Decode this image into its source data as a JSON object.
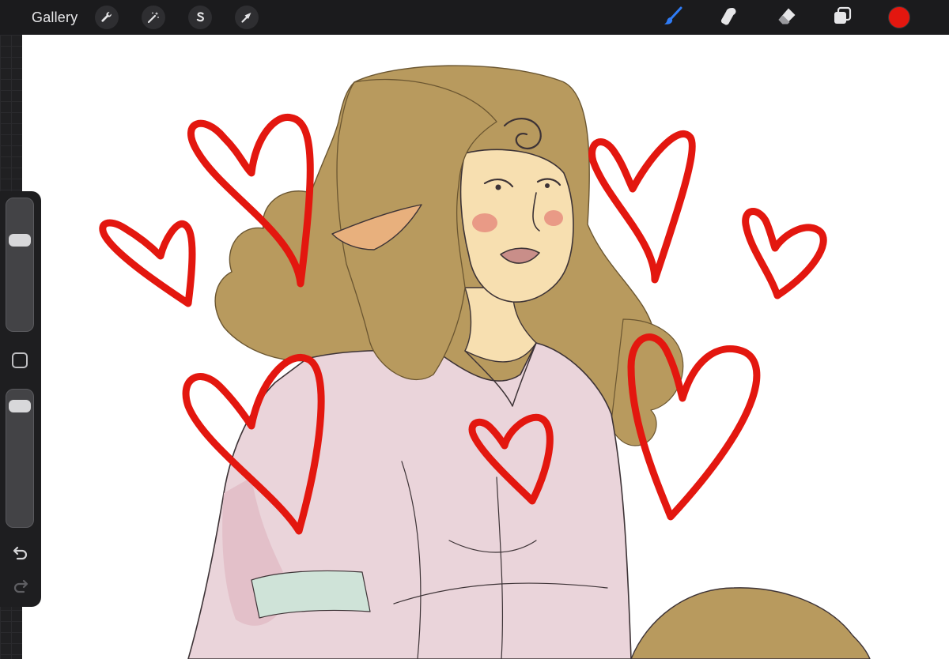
{
  "toolbar": {
    "gallery_label": "Gallery",
    "left_tools": [
      "wrench-icon",
      "magic-wand-icon",
      "selection-s-icon",
      "transform-arrow-icon"
    ],
    "right_tools": [
      "brush-icon",
      "smudge-icon",
      "eraser-icon",
      "layers-icon"
    ],
    "active_tool": "brush-icon",
    "current_color": "#e3170f"
  },
  "sidebar": {
    "brush_size_level": 0.28,
    "opacity_level": 0.05,
    "buttons": [
      "modify-button",
      "undo-button",
      "redo-button"
    ]
  },
  "canvas": {
    "artwork": "drawing-of-elf-woman-with-hearts",
    "colors": {
      "hair": "#b89a5e",
      "skin": "#f7dfb0",
      "dress": "#ead4da",
      "hearts": "#e3170f",
      "line": "#3d3336",
      "sash": "#cfe3d8"
    }
  }
}
